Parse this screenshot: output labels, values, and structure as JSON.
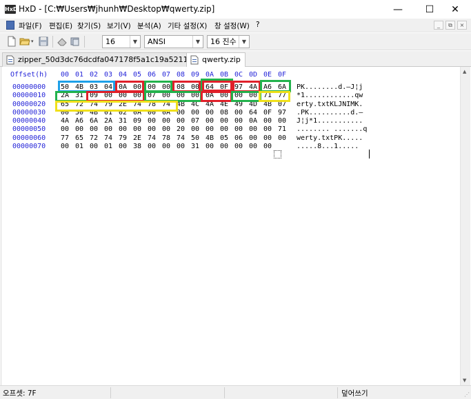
{
  "window": {
    "title": "HxD - [C:₩Users₩jhunh₩Desktop₩qwerty.zip]",
    "app_icon_text": "HxD",
    "controls": {
      "minimize": "—",
      "maximize": "☐",
      "close": "✕"
    }
  },
  "menu": {
    "items": [
      "파일(F)",
      "편집(E)",
      "찾기(S)",
      "보기(V)",
      "분석(A)",
      "기타 설정(X)",
      "창 설정(W)",
      "?"
    ],
    "mdi": {
      "minimize": "_",
      "restore": "⧉",
      "close": "×"
    }
  },
  "toolbar": {
    "bytes_per_row": "16",
    "charset": "ANSI",
    "offset_base": "16 진수"
  },
  "tabs": [
    {
      "label": "zipper_50d3dc76dcdfa047178f5a1c19a52118.zip",
      "active": false
    },
    {
      "label": "qwerty.zip",
      "active": true
    }
  ],
  "editor": {
    "offset_header": "Offset(h)",
    "column_headers": [
      "00",
      "01",
      "02",
      "03",
      "04",
      "05",
      "06",
      "07",
      "08",
      "09",
      "0A",
      "0B",
      "0C",
      "0D",
      "0E",
      "0F"
    ],
    "rows": [
      {
        "offset": "00000000",
        "bytes": [
          "50",
          "4B",
          "03",
          "04",
          "0A",
          "00",
          "00",
          "00",
          "08",
          "00",
          "64",
          "0F",
          "97",
          "4A",
          "A6",
          "6A"
        ],
        "ascii": "PK........d.—J¦j"
      },
      {
        "offset": "00000010",
        "bytes": [
          "2A",
          "31",
          "09",
          "00",
          "00",
          "00",
          "07",
          "00",
          "00",
          "00",
          "0A",
          "00",
          "00",
          "00",
          "71",
          "77"
        ],
        "ascii": "*1............qw"
      },
      {
        "offset": "00000020",
        "bytes": [
          "65",
          "72",
          "74",
          "79",
          "2E",
          "74",
          "78",
          "74",
          "4B",
          "4C",
          "4A",
          "4E",
          "49",
          "4D",
          "4B",
          "07"
        ],
        "ascii": "erty.txtKLJNIMK."
      },
      {
        "offset": "00000030",
        "bytes": [
          "00",
          "50",
          "4B",
          "01",
          "02",
          "0A",
          "00",
          "0A",
          "00",
          "00",
          "00",
          "08",
          "00",
          "64",
          "0F",
          "97"
        ],
        "ascii": ".PK..........d.—"
      },
      {
        "offset": "00000040",
        "bytes": [
          "4A",
          "A6",
          "6A",
          "2A",
          "31",
          "09",
          "00",
          "00",
          "00",
          "07",
          "00",
          "00",
          "00",
          "0A",
          "00",
          "00"
        ],
        "ascii": "J¦j*1..........."
      },
      {
        "offset": "00000050",
        "bytes": [
          "00",
          "00",
          "00",
          "00",
          "00",
          "00",
          "00",
          "00",
          "20",
          "00",
          "00",
          "00",
          "00",
          "00",
          "00",
          "71"
        ],
        "ascii": "........ .......q"
      },
      {
        "offset": "00000060",
        "bytes": [
          "77",
          "65",
          "72",
          "74",
          "79",
          "2E",
          "74",
          "78",
          "74",
          "50",
          "4B",
          "05",
          "06",
          "00",
          "00",
          "00"
        ],
        "ascii": "werty.txtPK....."
      },
      {
        "offset": "00000070",
        "bytes": [
          "00",
          "01",
          "00",
          "01",
          "00",
          "38",
          "00",
          "00",
          "00",
          "31",
          "00",
          "00",
          "00",
          "00",
          "00",
          ""
        ],
        "ascii": ".....8...1....."
      }
    ]
  },
  "status": {
    "offset": "오프셋: 7F",
    "mode": "덮어쓰기"
  },
  "colors": {
    "offset_blue": "#2323d8",
    "highlight_blue": "#1ea0e8",
    "highlight_red": "#e0202a",
    "highlight_green": "#22b24c",
    "highlight_yellow": "#f0e01a"
  }
}
